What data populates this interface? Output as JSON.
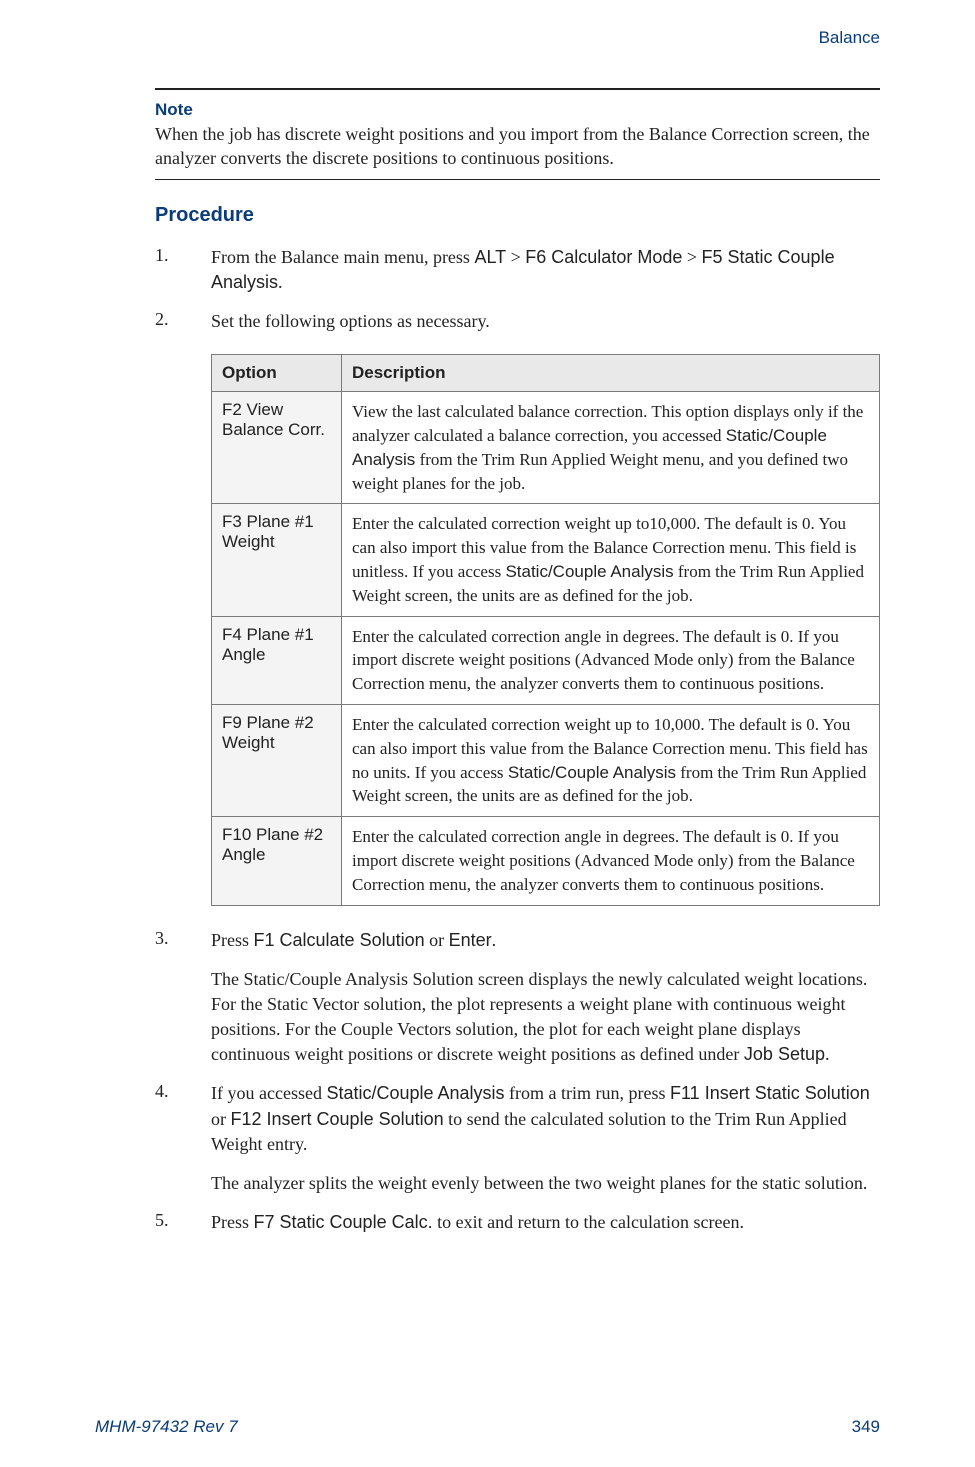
{
  "header": {
    "section": "Balance"
  },
  "note": {
    "label": "Note",
    "text": "When the job has discrete weight positions and you import from the Balance Correction screen, the analyzer converts the discrete positions to continuous positions."
  },
  "procedure": {
    "heading": "Procedure",
    "steps": {
      "s1_num": "1.",
      "s1_a": "From the Balance main menu, press ",
      "s1_b": "ALT",
      "s1_c": " > ",
      "s1_d": "F6 Calculator Mode",
      "s1_e": " > ",
      "s1_f": "F5 Static Couple Analysis",
      "s1_g": ".",
      "s2_num": "2.",
      "s2_a": "Set the following options as necessary.",
      "s3_num": "3.",
      "s3_a": "Press ",
      "s3_b": "F1 Calculate Solution",
      "s3_c": " or ",
      "s3_d": "Enter",
      "s3_e": ".",
      "s3_para_a": "The Static/Couple Analysis Solution screen displays the newly calculated weight locations. For the Static Vector solution, the plot represents a weight plane with continuous weight positions. For the Couple Vectors solution, the plot for each weight plane displays continuous weight positions or discrete weight positions as defined under ",
      "s3_para_b": "Job Setup",
      "s3_para_c": ".",
      "s4_num": "4.",
      "s4_a": "If you accessed ",
      "s4_b": "Static/Couple Analysis",
      "s4_c": " from a trim run, press ",
      "s4_d": "F11 Insert Static Solution",
      "s4_e": " or ",
      "s4_f": "F12 Insert Couple Solution",
      "s4_g": " to send the calculated solution to the Trim Run Applied Weight entry.",
      "s4_para": "The analyzer splits the weight evenly between the two weight planes for the static solution.",
      "s5_num": "5.",
      "s5_a": "Press ",
      "s5_b": "F7 Static Couple Calc.",
      "s5_c": " to exit and return to the calculation screen."
    }
  },
  "table": {
    "h_option": "Option",
    "h_desc": "Description",
    "r1_opt": "F2 View Balance Corr.",
    "r1_a": "View the last calculated balance correction. This option displays only if the analyzer calculated a balance correction, you accessed ",
    "r1_b": "Static/Couple Analysis",
    "r1_c": " from the Trim Run Applied Weight menu, and you defined two weight planes for the job.",
    "r2_opt": "F3 Plane #1 Weight",
    "r2_a": "Enter the calculated correction weight up to10,000. The default is 0. You can also import this value from the Balance Correction menu. This field is unitless. If you access ",
    "r2_b": "Static/Couple Analysis",
    "r2_c": " from the Trim Run Applied Weight screen, the units are as defined for the job.",
    "r3_opt": "F4 Plane #1 Angle",
    "r3_a": "Enter the calculated correction angle in degrees. The default is 0. If you import discrete weight positions (Advanced Mode only) from the Balance Correction menu, the analyzer converts them to continuous positions.",
    "r4_opt": "F9 Plane #2 Weight",
    "r4_a": "Enter the calculated correction weight up to 10,000. The default is 0. You can also import this value from the Balance Correction menu. This field has no units. If you access ",
    "r4_b": "Static/Couple Analysis",
    "r4_c": " from the Trim Run Applied Weight screen, the units are as defined for the job.",
    "r5_opt": "F10 Plane #2 Angle",
    "r5_a": "Enter the calculated correction angle in degrees. The default is 0. If you import discrete weight positions (Advanced Mode only) from the Balance Correction menu, the analyzer converts them to continuous positions."
  },
  "footer": {
    "doc": "MHM-97432 Rev 7",
    "page": "349"
  }
}
